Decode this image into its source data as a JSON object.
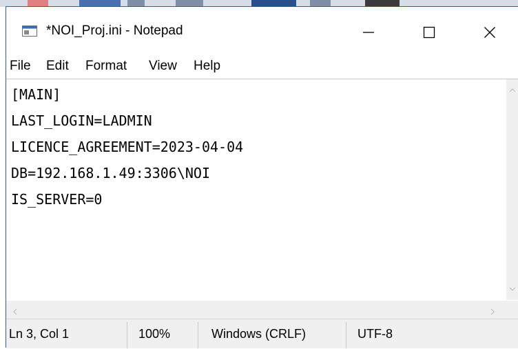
{
  "window": {
    "title": "*NOI_Proj.ini - Notepad",
    "controls": {
      "minimize": "—",
      "maximize": "☐",
      "close": "✕"
    }
  },
  "menu": {
    "file": "File",
    "edit": "Edit",
    "format": "Format",
    "view": "View",
    "help": "Help"
  },
  "editor": {
    "lines": [
      "[MAIN]",
      "LAST_LOGIN=LADMIN",
      "LICENCE_AGREEMENT=2023-04-04",
      "DB=192.168.1.49:3306\\NOI",
      "IS_SERVER=0"
    ]
  },
  "status": {
    "position": "Ln 3, Col 1",
    "zoom": "100%",
    "line_ending": "Windows (CRLF)",
    "encoding": "UTF-8"
  },
  "colors": {
    "window_border": "#2b5f9e",
    "statusbar_bg": "#f0f0f0",
    "scrollbar_bg": "#f0f0f0"
  },
  "icons": {
    "app": "notepad-icon",
    "scroll_up": "chevron-up-icon",
    "scroll_down": "chevron-down-icon",
    "scroll_left": "chevron-left-icon",
    "scroll_right": "chevron-right-icon"
  }
}
